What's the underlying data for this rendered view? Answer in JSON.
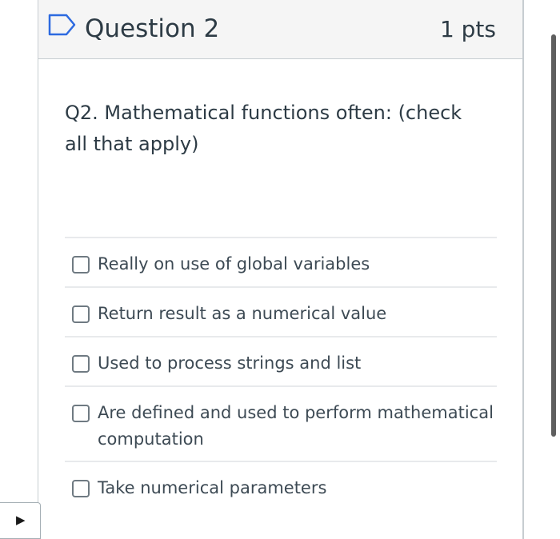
{
  "question": {
    "title": "Question 2",
    "points": "1 pts",
    "text": "Q2. Mathematical functions often: (check all that apply)",
    "flag_icon": "flag-bookmark-icon",
    "answers": [
      {
        "label": "Really on use of global variables",
        "checked": false
      },
      {
        "label": "Return result as a numerical value",
        "checked": false
      },
      {
        "label": "Used to process strings and list",
        "checked": false
      },
      {
        "label": "Are defined and used to perform mathematical computation",
        "checked": false
      },
      {
        "label": "Take numerical parameters",
        "checked": false
      }
    ]
  },
  "sidebar_toggle": {
    "icon": "play-triangle-icon",
    "glyph": "▶"
  },
  "colors": {
    "header_background": "#f5f5f5",
    "border": "#c7cdd1",
    "text": "#2d3b45",
    "flag_accent": "#2d6ae0"
  }
}
